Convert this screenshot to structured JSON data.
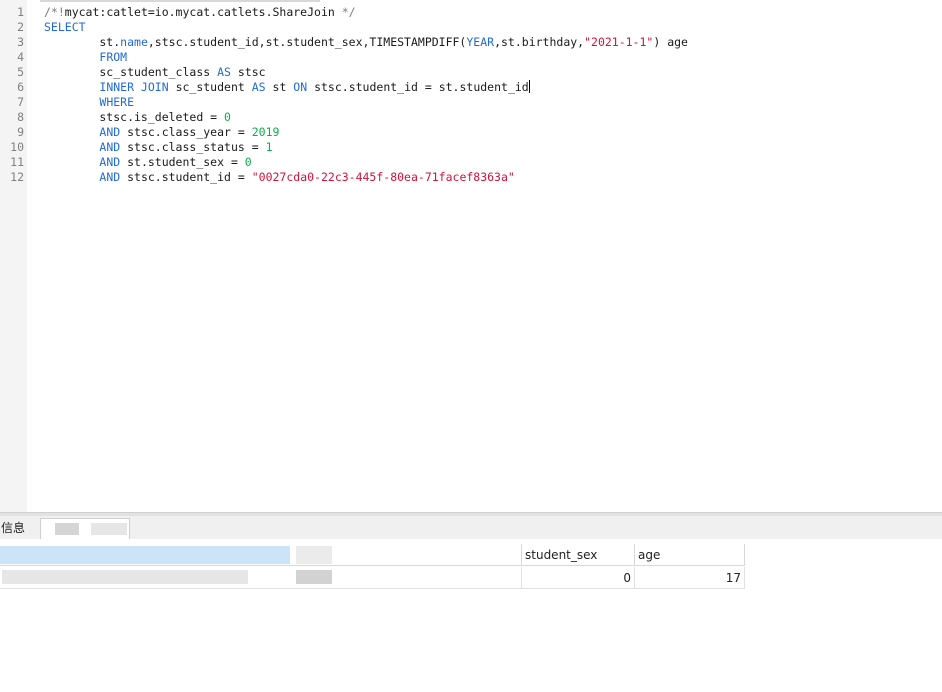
{
  "editor": {
    "lines": [
      {
        "n": "1",
        "tokens": [
          {
            "t": "/*!",
            "c": "cm"
          },
          {
            "t": "mycat:catlet=io.mycat.catlets.ShareJoin ",
            "c": ""
          },
          {
            "t": "*/",
            "c": "cm"
          }
        ]
      },
      {
        "n": "2",
        "tokens": [
          {
            "t": "SELECT",
            "c": "kw"
          }
        ]
      },
      {
        "n": "3",
        "tokens": [
          {
            "t": "        st.",
            "c": ""
          },
          {
            "t": "name",
            "c": "kw"
          },
          {
            "t": ",stsc.student_id,st.student_sex,TIMESTAMPDIFF(",
            "c": ""
          },
          {
            "t": "YEAR",
            "c": "kw"
          },
          {
            "t": ",st.birthday,",
            "c": ""
          },
          {
            "t": "\"2021-1-1\"",
            "c": "str"
          },
          {
            "t": ") age",
            "c": ""
          }
        ]
      },
      {
        "n": "4",
        "tokens": [
          {
            "t": "        ",
            "c": ""
          },
          {
            "t": "FROM",
            "c": "kw"
          }
        ]
      },
      {
        "n": "5",
        "tokens": [
          {
            "t": "        sc_student_class ",
            "c": ""
          },
          {
            "t": "AS",
            "c": "kw"
          },
          {
            "t": " stsc",
            "c": ""
          }
        ]
      },
      {
        "n": "6",
        "tokens": [
          {
            "t": "        ",
            "c": ""
          },
          {
            "t": "INNER JOIN",
            "c": "kw"
          },
          {
            "t": " sc_student ",
            "c": ""
          },
          {
            "t": "AS",
            "c": "kw"
          },
          {
            "t": " st ",
            "c": ""
          },
          {
            "t": "ON",
            "c": "kw"
          },
          {
            "t": " stsc.student_id = st.student_id",
            "c": ""
          }
        ],
        "caret": true
      },
      {
        "n": "7",
        "tokens": [
          {
            "t": "        ",
            "c": ""
          },
          {
            "t": "WHERE",
            "c": "kw"
          }
        ]
      },
      {
        "n": "8",
        "tokens": [
          {
            "t": "        stsc.is_deleted = ",
            "c": ""
          },
          {
            "t": "0",
            "c": "num"
          }
        ]
      },
      {
        "n": "9",
        "tokens": [
          {
            "t": "        ",
            "c": ""
          },
          {
            "t": "AND",
            "c": "kw"
          },
          {
            "t": " stsc.class_year = ",
            "c": ""
          },
          {
            "t": "2019",
            "c": "num"
          }
        ]
      },
      {
        "n": "10",
        "tokens": [
          {
            "t": "        ",
            "c": ""
          },
          {
            "t": "AND",
            "c": "kw"
          },
          {
            "t": " stsc.class_status = ",
            "c": ""
          },
          {
            "t": "1",
            "c": "num"
          }
        ]
      },
      {
        "n": "11",
        "tokens": [
          {
            "t": "        ",
            "c": ""
          },
          {
            "t": "AND",
            "c": "kw"
          },
          {
            "t": " st.student_sex = ",
            "c": ""
          },
          {
            "t": "0",
            "c": "num"
          }
        ]
      },
      {
        "n": "12",
        "tokens": [
          {
            "t": "        ",
            "c": ""
          },
          {
            "t": "AND",
            "c": "kw"
          },
          {
            "t": " stsc.student_id = ",
            "c": ""
          },
          {
            "t": "\"0027cda0-22c3-445f-80ea-71facef8363a\"",
            "c": "str"
          }
        ]
      }
    ]
  },
  "bottom": {
    "tab_info": "信息"
  },
  "result": {
    "columns": [
      "student_sex",
      "age"
    ],
    "row": [
      "0",
      "17"
    ]
  }
}
